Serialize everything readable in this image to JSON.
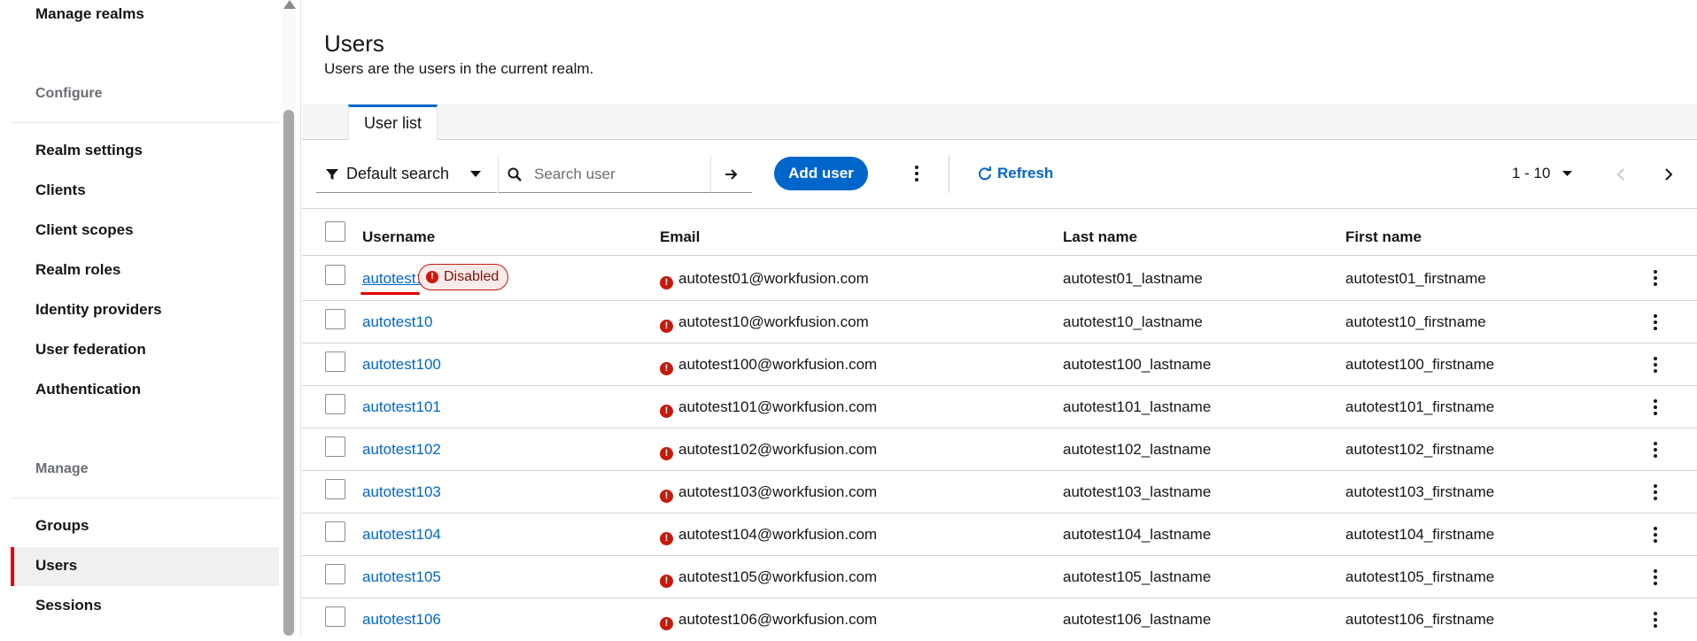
{
  "sidebar": {
    "top_link": "Manage realms",
    "sections": [
      {
        "label": "Configure",
        "items": [
          "Realm settings",
          "Clients",
          "Client scopes",
          "Realm roles",
          "Identity providers",
          "User federation",
          "Authentication"
        ]
      },
      {
        "label": "Manage",
        "items": [
          "Groups",
          "Users",
          "Sessions"
        ]
      }
    ],
    "active_item": "Users"
  },
  "header": {
    "title": "Users",
    "subtitle": "Users are the users in the current realm."
  },
  "tabs": [
    {
      "label": "User list",
      "active": true
    }
  ],
  "toolbar": {
    "filter_label": "Default search",
    "search_placeholder": "Search user",
    "add_label": "Add user",
    "refresh_label": "Refresh",
    "pagination": "1 - 10"
  },
  "table": {
    "columns": [
      "Username",
      "Email",
      "Last name",
      "First name"
    ],
    "rows": [
      {
        "username": "autotest1",
        "badge": "Disabled",
        "email": "autotest01@workfusion.com",
        "last": "autotest01_lastname",
        "first": "autotest01_firstname"
      },
      {
        "username": "autotest10",
        "email": "autotest10@workfusion.com",
        "last": "autotest10_lastname",
        "first": "autotest10_firstname"
      },
      {
        "username": "autotest100",
        "email": "autotest100@workfusion.com",
        "last": "autotest100_lastname",
        "first": "autotest100_firstname"
      },
      {
        "username": "autotest101",
        "email": "autotest101@workfusion.com",
        "last": "autotest101_lastname",
        "first": "autotest101_firstname"
      },
      {
        "username": "autotest102",
        "email": "autotest102@workfusion.com",
        "last": "autotest102_lastname",
        "first": "autotest102_firstname"
      },
      {
        "username": "autotest103",
        "email": "autotest103@workfusion.com",
        "last": "autotest103_lastname",
        "first": "autotest103_firstname"
      },
      {
        "username": "autotest104",
        "email": "autotest104@workfusion.com",
        "last": "autotest104_lastname",
        "first": "autotest104_firstname"
      },
      {
        "username": "autotest105",
        "email": "autotest105@workfusion.com",
        "last": "autotest105_lastname",
        "first": "autotest105_firstname"
      },
      {
        "username": "autotest106",
        "email": "autotest106@workfusion.com",
        "last": "autotest106_lastname",
        "first": "autotest106_firstname"
      }
    ]
  },
  "colors": {
    "accent": "#0066cc",
    "danger": "#c9190b",
    "active_marker": "#ee0000"
  }
}
